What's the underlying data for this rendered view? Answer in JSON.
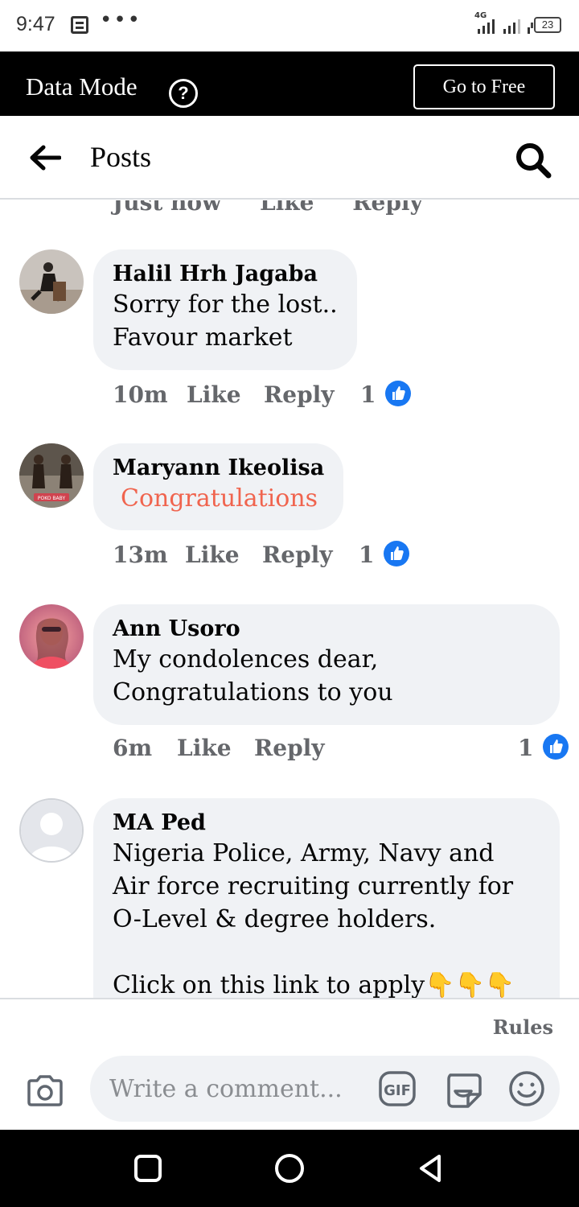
{
  "status_bar": {
    "time": "9:47",
    "network": "4G",
    "battery": "23"
  },
  "data_mode": {
    "title": "Data Mode",
    "help": "?",
    "button": "Go to Free"
  },
  "header": {
    "title": "Posts"
  },
  "previous_comment_actions": [
    "Just now",
    "Like",
    "Reply"
  ],
  "comments": [
    {
      "author": "Halil Hrh Jagaba",
      "lines": [
        "Sorry for the lost..",
        "Favour market"
      ],
      "time": "10m",
      "like": "Like",
      "reply": "Reply",
      "reaction_count": "1"
    },
    {
      "author": "Maryann Ikeolisa",
      "lines": [
        "Congratulations"
      ],
      "time": "13m",
      "like": "Like",
      "reply": "Reply",
      "reaction_count": "1"
    },
    {
      "author": "Ann Usoro",
      "lines": [
        "My condolences dear,",
        "Congratulations to you"
      ],
      "time": "6m",
      "like": "Like",
      "reply": "Reply",
      "reaction_count": "1"
    },
    {
      "author": "MA Ped",
      "lines": [
        "Nigeria Police, Army, Navy and",
        "Air force recruiting currently for",
        "O-Level & degree holders.",
        "",
        "Click on this link to apply👇👇👇"
      ]
    }
  ],
  "footer": {
    "rules": "Rules",
    "input_placeholder": "Write a comment..."
  },
  "colors": {
    "accent_text": "#f0644e",
    "like_blue": "#1877f2",
    "bubble": "#f0f2f5",
    "meta": "#65676b"
  }
}
